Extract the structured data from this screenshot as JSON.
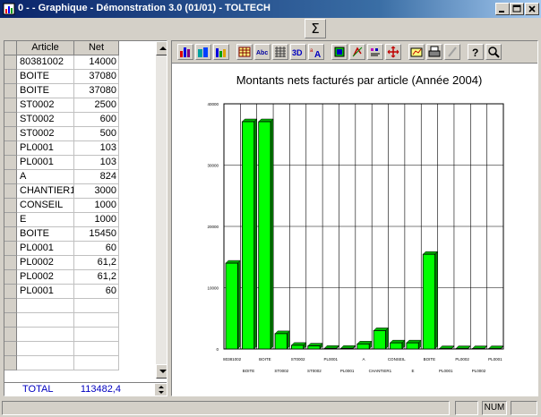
{
  "window": {
    "title": "0 -  - Graphique - Démonstration 3.0 (01/01) - TOLTECH"
  },
  "icons": {
    "minimize": "minimize-icon",
    "maximize": "maximize-icon",
    "close": "close-icon",
    "sigma": "sigma-icon"
  },
  "toolbar_top": {
    "sigma_label": "Σ"
  },
  "grid": {
    "headers": {
      "article": "Article",
      "net": "Net"
    },
    "rows": [
      {
        "article": "80381002",
        "net": "14000"
      },
      {
        "article": "BOITE",
        "net": "37080"
      },
      {
        "article": "BOITE",
        "net": "37080"
      },
      {
        "article": "ST0002",
        "net": "2500"
      },
      {
        "article": "ST0002",
        "net": "600"
      },
      {
        "article": "ST0002",
        "net": "500"
      },
      {
        "article": "PL0001",
        "net": "103"
      },
      {
        "article": "PL0001",
        "net": "103"
      },
      {
        "article": "A",
        "net": "824"
      },
      {
        "article": "CHANTIER1",
        "net": "3000"
      },
      {
        "article": "CONSEIL",
        "net": "1000"
      },
      {
        "article": "E",
        "net": "1000"
      },
      {
        "article": "BOITE",
        "net": "15450"
      },
      {
        "article": "PL0001",
        "net": "60"
      },
      {
        "article": "PL0002",
        "net": "61,2"
      },
      {
        "article": "PL0002",
        "net": "61,2"
      },
      {
        "article": "PL0001",
        "net": "60"
      }
    ],
    "total_label": "TOTAL",
    "total_value": "113482,4"
  },
  "chart_toolbar": {
    "buttons": [
      "bar-chart-icon",
      "3d-bar-chart-icon",
      "stacked-bar-icon",
      "table-icon",
      "abc-labels-icon",
      "grid-icon",
      "3d-toggle-icon",
      "font-size-icon",
      "color-palette-icon",
      "rotate-icon",
      "legend-icon",
      "move-icon",
      "copy-chart-icon",
      "print-icon",
      "pen-icon",
      "help-icon",
      "zoom-icon"
    ]
  },
  "chart_data": {
    "type": "bar",
    "title": "Montants nets facturés par article (Année 2004)",
    "categories": [
      "80381002",
      "BOITE",
      "BOITE",
      "ST0002",
      "ST0002",
      "ST0002",
      "PL0001",
      "PL0001",
      "A",
      "CHANTIER1",
      "CONSEIL",
      "E",
      "BOITE",
      "PL0001",
      "PL0002",
      "PL0002",
      "PL0001"
    ],
    "values": [
      14000,
      37080,
      37080,
      2500,
      600,
      500,
      103,
      103,
      824,
      3000,
      1000,
      1000,
      15450,
      60,
      61.2,
      61.2,
      60
    ],
    "ylim": [
      0,
      40000
    ],
    "yticks": [
      "0",
      "10000",
      "20000",
      "30000",
      "40000"
    ],
    "grid": true,
    "bar_color": "#00ff00",
    "xlabel": "",
    "ylabel": ""
  },
  "statusbar": {
    "num_label": "NUM"
  }
}
